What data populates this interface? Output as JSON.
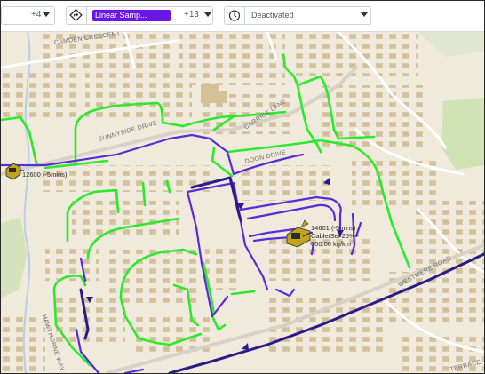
{
  "toolbar": {
    "filter1_count": "+4",
    "filter2_chip": "Linear Samp...",
    "filter2_count": "+13",
    "filter3_status": "Deactivated"
  },
  "map": {
    "street_labels": {
      "camden": "CAMDEN CRESCENT",
      "sunnyside": "SUNNYSIDE DRIVE",
      "carrick": "CARRICK LANE",
      "doon": "DOON DRIVE",
      "westmere": "WESTMERE ROAD",
      "hawthorne": "HAWTHORNE WAY",
      "terrace": "TERRACE"
    },
    "unit_labels": {
      "left": "12600 (-5mins)",
      "center_line1": "14601 (-5mins)",
      "center_line2": "Cable/Sel 25% -",
      "center_line3": "600.00 kg/km"
    }
  },
  "colors": {
    "chip": "#6b16e8",
    "route_green": "#2bea2b",
    "route_purple": "#5a2bd8",
    "route_dark": "#2a1a8a",
    "map_background": "#efeadc",
    "building": "#dac9a8"
  },
  "icons": [
    "chevron-down-icon",
    "route-diamond-icon",
    "clock-icon",
    "vehicle-icon"
  ]
}
